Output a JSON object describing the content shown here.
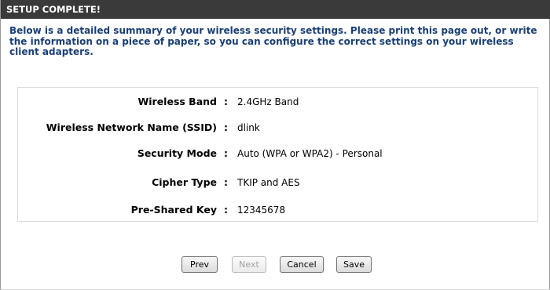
{
  "header": {
    "title": "SETUP COMPLETE!"
  },
  "intro": "Below is a detailed summary of your wireless security settings. Please print this page out, or write the information on a piece of paper, so you can configure the correct settings on your wireless client adapters.",
  "summary": {
    "separator": ":",
    "rows": [
      {
        "label": "Wireless Band",
        "value": "2.4GHz Band"
      },
      {
        "label": "Wireless Network Name (SSID)",
        "value": "dlink"
      },
      {
        "label": "Security Mode",
        "value": "Auto (WPA or WPA2) - Personal"
      },
      {
        "label": "Cipher Type",
        "value": "TKIP and AES"
      },
      {
        "label": "Pre-Shared Key",
        "value": "12345678"
      }
    ]
  },
  "buttons": {
    "prev": "Prev",
    "next": "Next",
    "cancel": "Cancel",
    "save": "Save"
  },
  "colors": {
    "header_bg": "#3a3a3a",
    "intro_text": "#1a3f73"
  }
}
